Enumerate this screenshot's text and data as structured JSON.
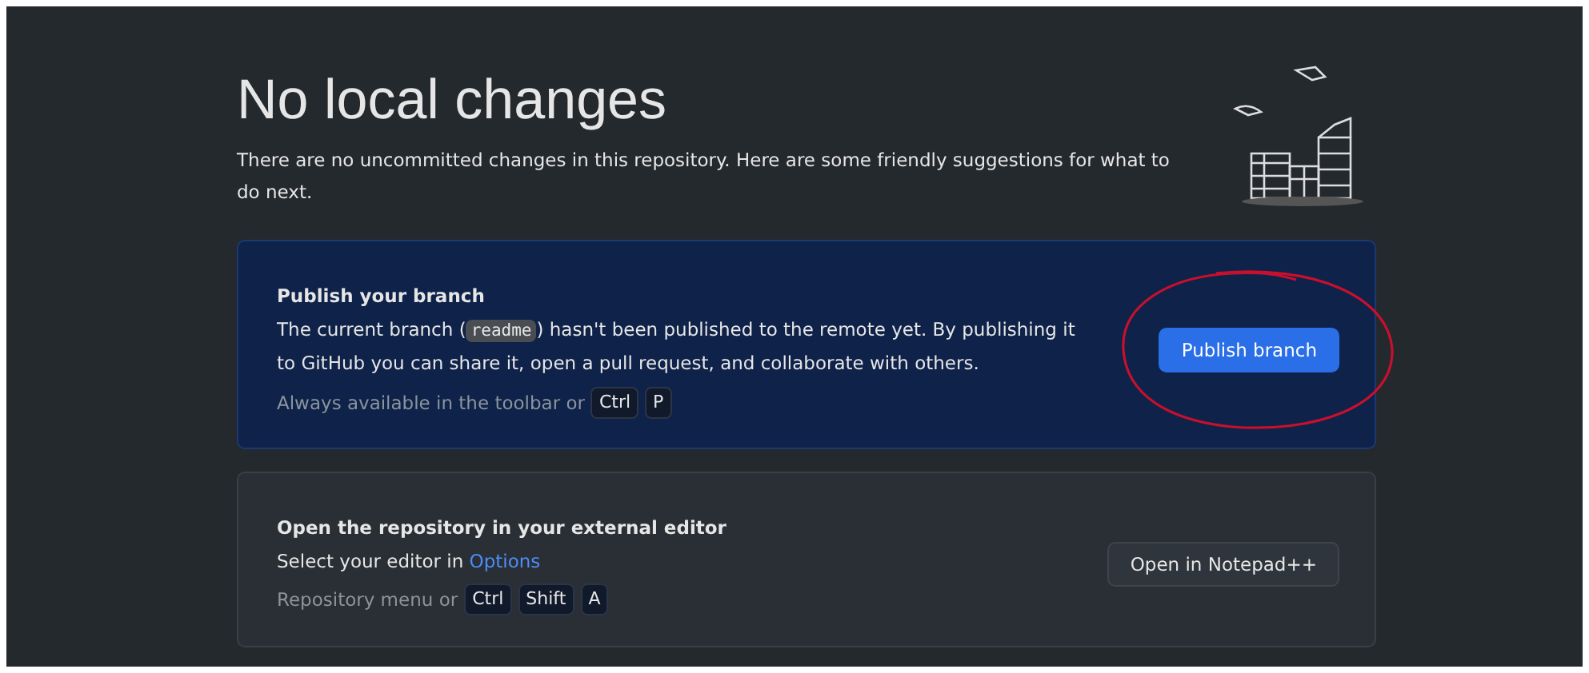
{
  "header": {
    "title": "No local changes",
    "description": "There are no uncommitted changes in this repository. Here are some friendly suggestions for what to do next."
  },
  "cards": [
    {
      "kind": "publish",
      "highlighted": true,
      "title": "Publish your branch",
      "text_before": "The current branch (",
      "branch": "readme",
      "text_after": ") hasn't been published to the remote yet. By publishing it to GitHub you can share it, open a pull request, and collaborate with others.",
      "hint": "Always available in the toolbar or",
      "keys": [
        "Ctrl",
        "P"
      ],
      "button": {
        "label": "Publish branch",
        "primary": true
      },
      "circled": true
    },
    {
      "kind": "editor",
      "highlighted": false,
      "title": "Open the repository in your external editor",
      "text_before": "Select your editor in ",
      "link": "Options",
      "hint": "Repository menu or",
      "keys": [
        "Ctrl",
        "Shift",
        "A"
      ],
      "button": {
        "label": "Open in Notepad++",
        "primary": false
      },
      "circled": false
    }
  ]
}
